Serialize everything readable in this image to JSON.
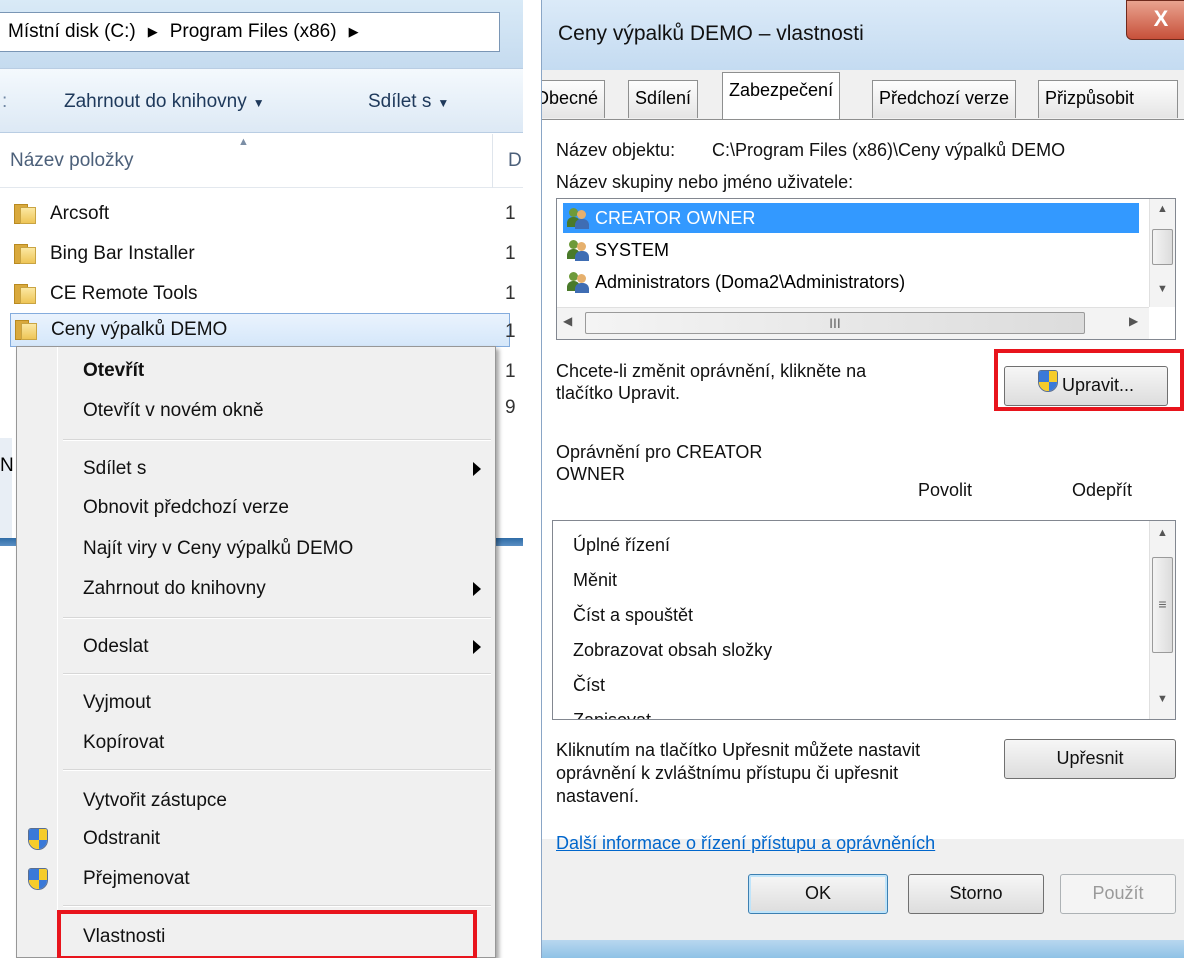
{
  "explorer": {
    "breadcrumb": [
      "Místní disk (C:)",
      "Program Files (x86)"
    ],
    "toolbar": {
      "include_label": "Zahrnout do knihovny",
      "share_label": "Sdílet s"
    },
    "column_name": "Název položky",
    "column_next_partial": "D",
    "files": [
      {
        "name": "Arcsoft",
        "date_partial": "1"
      },
      {
        "name": "Bing Bar Installer",
        "date_partial": "1"
      },
      {
        "name": "CE Remote Tools",
        "date_partial": "1"
      },
      {
        "name": "Ceny výpalků DEMO",
        "date_partial": "1"
      }
    ],
    "extra_partials": [
      "1",
      "9"
    ],
    "side_partial": "N"
  },
  "context_menu": {
    "open": "Otevřít",
    "open_new_window": "Otevřít v novém okně",
    "share_with": "Sdílet s",
    "restore_previous": "Obnovit předchozí verze",
    "scan_viruses": "Najít viry v Ceny výpalků DEMO",
    "include_library": "Zahrnout do knihovny",
    "send_to": "Odeslat",
    "cut": "Vyjmout",
    "copy": "Kopírovat",
    "create_shortcut": "Vytvořit zástupce",
    "delete": "Odstranit",
    "rename": "Přejmenovat",
    "properties": "Vlastnosti"
  },
  "dialog": {
    "title": "Ceny výpalků DEMO – vlastnosti",
    "close_glyph": "X",
    "tabs": [
      "Obecné",
      "Sdílení",
      "Zabezpečení",
      "Předchozí verze",
      "Přizpůsobit"
    ],
    "active_tab": "Zabezpečení",
    "object_label": "Název objektu:",
    "object_path": "C:\\Program Files (x86)\\Ceny výpalků DEMO",
    "group_label": "Název skupiny nebo jméno uživatele:",
    "users": [
      "CREATOR OWNER",
      "SYSTEM",
      "Administrators (Doma2\\Administrators)"
    ],
    "hscroll_grip": "III",
    "change_hint_1": "Chcete-li změnit oprávnění, klikněte na",
    "change_hint_2": "tlačítko Upravit.",
    "edit_button": "Upravit...",
    "perm_title_1": "Oprávnění pro CREATOR",
    "perm_title_2": "OWNER",
    "allow_label": "Povolit",
    "deny_label": "Odepřít",
    "permissions": [
      "Úplné řízení",
      "Měnit",
      "Číst a spouštět",
      "Zobrazovat obsah složky",
      "Číst",
      "Zapisovat"
    ],
    "advanced_hint_1": "Kliknutím na tlačítko Upřesnit můžete nastavit",
    "advanced_hint_2": "oprávnění k zvláštnímu přístupu či upřesnit",
    "advanced_hint_3": "nastavení.",
    "advanced_button": "Upřesnit",
    "info_link": "Další informace o řízení přístupu a oprávněních",
    "ok": "OK",
    "cancel": "Storno",
    "apply": "Použít"
  },
  "colors": {
    "highlight": "#e8141c",
    "selection": "#3399ff",
    "link": "#0066cc"
  }
}
